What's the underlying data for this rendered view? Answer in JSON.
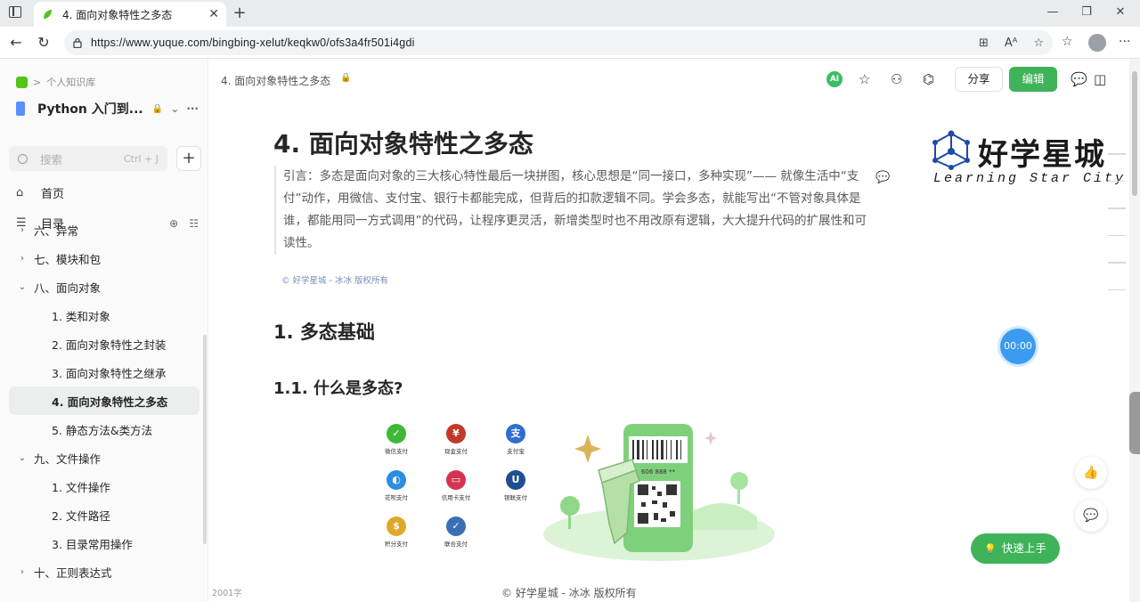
{
  "browser": {
    "tab_title": "4. 面向对象特性之多态",
    "tab_close": "✕",
    "new_tab": "+",
    "url": "https://www.yuque.com/bingbing-xelut/keqkw0/ofs3a4fr501i4gdi",
    "minimize": "—",
    "restore": "❐",
    "close": "✕"
  },
  "sidebar": {
    "breadcrumb_sep": ">",
    "breadcrumb": "个人知识库",
    "book_title": "Python 入门到...",
    "book_lock": "🔒",
    "book_chevron": "⌄",
    "book_more": "···",
    "search_placeholder": "搜索",
    "search_shortcut": "Ctrl + J",
    "add": "+",
    "home": "首页",
    "toc": "目录",
    "toc_items": [
      {
        "label": "六、异常",
        "arrow": "›",
        "level": 0
      },
      {
        "label": "七、模块和包",
        "arrow": "›",
        "level": 0
      },
      {
        "label": "八、面向对象",
        "arrow": "⌄",
        "level": 0
      },
      {
        "label": "1. 类和对象",
        "arrow": "",
        "level": 1
      },
      {
        "label": "2. 面向对象特性之封装",
        "arrow": "",
        "level": 1
      },
      {
        "label": "3. 面向对象特性之继承",
        "arrow": "",
        "level": 1
      },
      {
        "label": "4. 面向对象特性之多态",
        "arrow": "",
        "level": 1,
        "active": true
      },
      {
        "label": "5. 静态方法&类方法",
        "arrow": "",
        "level": 1
      },
      {
        "label": "九、文件操作",
        "arrow": "⌄",
        "level": 0
      },
      {
        "label": "1. 文件操作",
        "arrow": "",
        "level": 1
      },
      {
        "label": "2. 文件路径",
        "arrow": "",
        "level": 1
      },
      {
        "label": "3. 目录常用操作",
        "arrow": "",
        "level": 1
      },
      {
        "label": "十、正则表达式",
        "arrow": "›",
        "level": 0
      }
    ]
  },
  "header": {
    "doc_crumb": "4. 面向对象特性之多态",
    "ai": "AI",
    "share": "分享",
    "edit": "编辑"
  },
  "doc": {
    "title": "4. 面向对象特性之多态",
    "quote": "引言：多态是面向对象的三大核心特性最后一块拼图，核心思想是“同一接口，多种实现”—— 就像生活中“支付”动作，用微信、支付宝、银行卡都能完成，但背后的扣款逻辑不同。学会多态，就能写出“不管对象具体是谁，都能用同一方式调用”的代码，让程序更灵活，新增类型时也不用改原有逻辑，大大提升代码的扩展性和可读性。",
    "quote_copyright": "© 好学星城 - 冰冰 版权所有",
    "h1": "1. 多态基础",
    "h2": "1.1. 什么是多态?",
    "brand_name": "好学星城",
    "brand_sub": "Learning Star City",
    "pay_methods": [
      {
        "label": "微信支付",
        "color": "#3fb83a",
        "glyph": "✓"
      },
      {
        "label": "现金支付",
        "color": "#c0392b",
        "glyph": "¥"
      },
      {
        "label": "支付宝",
        "color": "#2f6ecf",
        "glyph": "支"
      },
      {
        "label": "花呗支付",
        "color": "#2d8de0",
        "glyph": "◐"
      },
      {
        "label": "信用卡支付",
        "color": "#d6334f",
        "glyph": "▭"
      },
      {
        "label": "银联支付",
        "color": "#1f4f8f",
        "glyph": "U"
      },
      {
        "label": "积分支付",
        "color": "#e0a82a",
        "glyph": "$"
      },
      {
        "label": "联合支付",
        "color": "#3a6fb5",
        "glyph": "✓"
      }
    ],
    "barcode_number": "606 888 **",
    "word_count": "2001字",
    "footer_copyright": "© 好学星城 - 冰冰 版权所有"
  },
  "widgets": {
    "timer": "00:00",
    "quick_start": "快速上手"
  }
}
